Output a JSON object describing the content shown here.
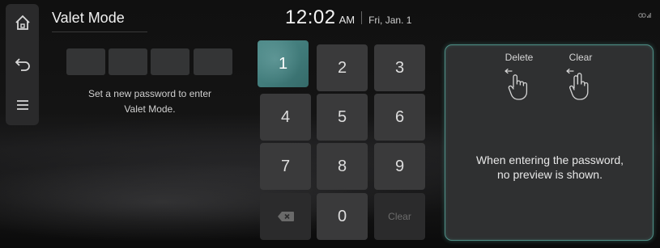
{
  "header": {
    "title": "Valet Mode",
    "time": "12:02",
    "ampm": "AM",
    "date": "Fri, Jan. 1"
  },
  "sidebar": {
    "items": [
      {
        "icon": "home-icon"
      },
      {
        "icon": "back-icon"
      },
      {
        "icon": "menu-icon"
      }
    ]
  },
  "password": {
    "box_count": 4,
    "hint_line1": "Set a new password to enter",
    "hint_line2": "Valet Mode."
  },
  "keypad": {
    "keys": [
      "1",
      "2",
      "3",
      "4",
      "5",
      "6",
      "7",
      "8",
      "9",
      "⌫",
      "0",
      "Clear"
    ],
    "active_key": "1"
  },
  "panel": {
    "delete_label": "Delete",
    "clear_label": "Clear",
    "message_line1": "When entering the password,",
    "message_line2": "no preview is shown."
  },
  "colors": {
    "accent": "#4f8b8a",
    "panel_border": "#4f8f86",
    "key_bg": "#3a3a3b"
  }
}
